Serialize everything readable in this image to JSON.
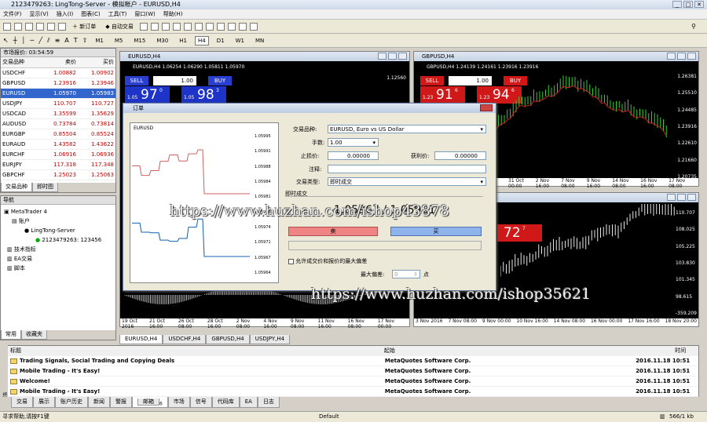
{
  "window": {
    "title": "2123479263: LingTong-Server - 模拟帐户 - EURUSD,H4"
  },
  "menu": [
    "文件(F)",
    "显示(V)",
    "插入(I)",
    "图表(C)",
    "工具(T)",
    "窗口(W)",
    "帮助(H)"
  ],
  "toolbar": {
    "new_order": "新订单",
    "auto_trade": "自动交易"
  },
  "timeframes": [
    "M1",
    "M5",
    "M15",
    "M30",
    "H1",
    "H4",
    "D1",
    "W1",
    "MN"
  ],
  "market_watch": {
    "header": "市场报价: 03:54:59",
    "col_symbol": "交易品种",
    "col_bid": "卖价",
    "col_ask": "买价",
    "rows": [
      {
        "s": "USDCHF",
        "b": "1.00882",
        "a": "1.00902"
      },
      {
        "s": "GBPUSD",
        "b": "1.23916",
        "a": "1.23946"
      },
      {
        "s": "EURUSD",
        "b": "1.05970",
        "a": "1.05983"
      },
      {
        "s": "USDJPY",
        "b": "110.707",
        "a": "110.727"
      },
      {
        "s": "USDCAD",
        "b": "1.35599",
        "a": "1.35629"
      },
      {
        "s": "AUDUSD",
        "b": "0.73784",
        "a": "0.73814"
      },
      {
        "s": "EURGBP",
        "b": "0.85504",
        "a": "0.85524"
      },
      {
        "s": "EURAUD",
        "b": "1.43582",
        "a": "1.43622"
      },
      {
        "s": "EURCHF",
        "b": "1.06916",
        "a": "1.06936"
      },
      {
        "s": "EURJPY",
        "b": "117.318",
        "a": "117.348"
      },
      {
        "s": "GBPCHF",
        "b": "1.25023",
        "a": "1.25063"
      }
    ],
    "tab1": "交易品种",
    "tab2": "即时图"
  },
  "navigator": {
    "header": "导航",
    "root": "MetaTrader 4",
    "accounts": "账户",
    "server": "LingTong-Server",
    "account": "2123479263: 123456",
    "indicators": "技术指标",
    "ea": "EA交易",
    "scripts": "脚本",
    "tab1": "常用",
    "tab2": "收藏夹"
  },
  "chart_eur": {
    "title": "EURUSD,H4",
    "ohlc": "EURUSD,H4  1.06254 1.06290 1.05811 1.05970",
    "sell": "SELL",
    "buy": "BUY",
    "lot": "1.00",
    "sell_small": "1.05",
    "sell_big": "97",
    "sell_sup": "0",
    "buy_small": "1.05",
    "buy_big": "98",
    "buy_sup": "3",
    "dates": [
      "19 Oct 2016",
      "21 Oct 16:00",
      "26 Oct 08:00",
      "28 Oct 16:00",
      "2 Nov 08:00",
      "4 Nov 16:00",
      "9 Nov 08:00",
      "11 Nov 16:00",
      "16 Nov 08:00",
      "17 Nov 00:00"
    ],
    "price_top": "1.12560"
  },
  "chart_gbp": {
    "title": "GBPUSD,H4",
    "ohlc": "GBPUSD,H4  1.24139 1.24161 1.23916 1.23916",
    "sell": "SELL",
    "buy": "BUY",
    "lot": "1.00",
    "sell_small": "1.23",
    "sell_big": "91",
    "sell_sup": "6",
    "buy_small": "1.23",
    "buy_big": "94",
    "buy_sup": "6",
    "prices": [
      "1.26381",
      "1.25510",
      "1.24485",
      "1.23916",
      "1.22610",
      "1.21660",
      "1.20735"
    ],
    "dates": [
      "31 Oct 00:00",
      "2 Nov 16:00",
      "7 Nov 08:00",
      "9 Nov 16:00",
      "14 Nov 08:00",
      "16 Nov 16:00",
      "17 Nov 08:00"
    ]
  },
  "chart_jpy": {
    "big": "72",
    "sup": "7",
    "prices": [
      "110.707",
      "108.025",
      "105.225",
      "103.830",
      "101.345",
      "98.615",
      "-359.209"
    ],
    "dates": [
      "3 Nov 2016",
      "7 Nov 08:00",
      "9 Nov 00:00",
      "10 Nov 16:00",
      "14 Nov 08:00",
      "16 Nov 00:00",
      "17 Nov 16:00",
      "18 Nov 20:00"
    ]
  },
  "chart_tabs": [
    "EURUSD,H4",
    "USDCHF,H4",
    "GBPUSD,H4",
    "USDJPY,H4"
  ],
  "dialog": {
    "title": "订单",
    "mini_chart_symbol": "EURUSD",
    "symbol_label": "交易品种:",
    "symbol_value": "EURUSD, Euro vs US Dollar",
    "volume_label": "手数:",
    "volume_value": "1.00",
    "sl_label": "止损价:",
    "sl_value": "0.00000",
    "tp_label": "获利价:",
    "tp_value": "0.00000",
    "comment_label": "注释:",
    "comment_value": "",
    "type_label": "交易类型:",
    "type_value": "即时成交",
    "section_label": "即时成交",
    "quote": "1.05967 / 1.05981",
    "sell_btn": "卖",
    "buy_btn": "买",
    "dev_label": "允许成交价和报价的最大偏差",
    "max_dev_label": "最大偏差:",
    "max_dev_value": "0",
    "max_dev_unit": "点",
    "axis_prices": [
      "1.05995",
      "1.05991",
      "1.05988",
      "1.05984",
      "1.05981",
      "1.05978",
      "1.05974",
      "1.05971",
      "1.05967",
      "1.05964"
    ]
  },
  "terminal": {
    "col_title": "标题",
    "col_source": "起始",
    "col_time": "时间",
    "rows": [
      {
        "t": "Trading Signals, Social Trading and Copying Deals",
        "s": "MetaQuotes Software Corp.",
        "d": "2016.11.18 10:51"
      },
      {
        "t": "Mobile Trading - It's Easy!",
        "s": "MetaQuotes Software Corp.",
        "d": "2016.11.18 10:51"
      },
      {
        "t": "Welcome!",
        "s": "MetaQuotes Software Corp.",
        "d": "2016.11.18 10:51"
      },
      {
        "t": "Mobile Trading - It's Easy!",
        "s": "MetaQuotes Software Corp.",
        "d": "2016.11.18 10:51"
      }
    ],
    "tabs": [
      "交易",
      "展示",
      "账户历史",
      "新闻",
      "警报",
      "邮箱",
      "市场",
      "信号",
      "代码库",
      "EA",
      "日志"
    ],
    "mail_count": "6",
    "side_label": "终端"
  },
  "status": {
    "help": "寻求帮助,请按F1键",
    "profile": "Default",
    "traffic": "566/1 kb"
  },
  "watermarks": [
    "https://www.huzhan.com/ishop43878",
    "https://www.huzhan.com/ishop35621"
  ]
}
